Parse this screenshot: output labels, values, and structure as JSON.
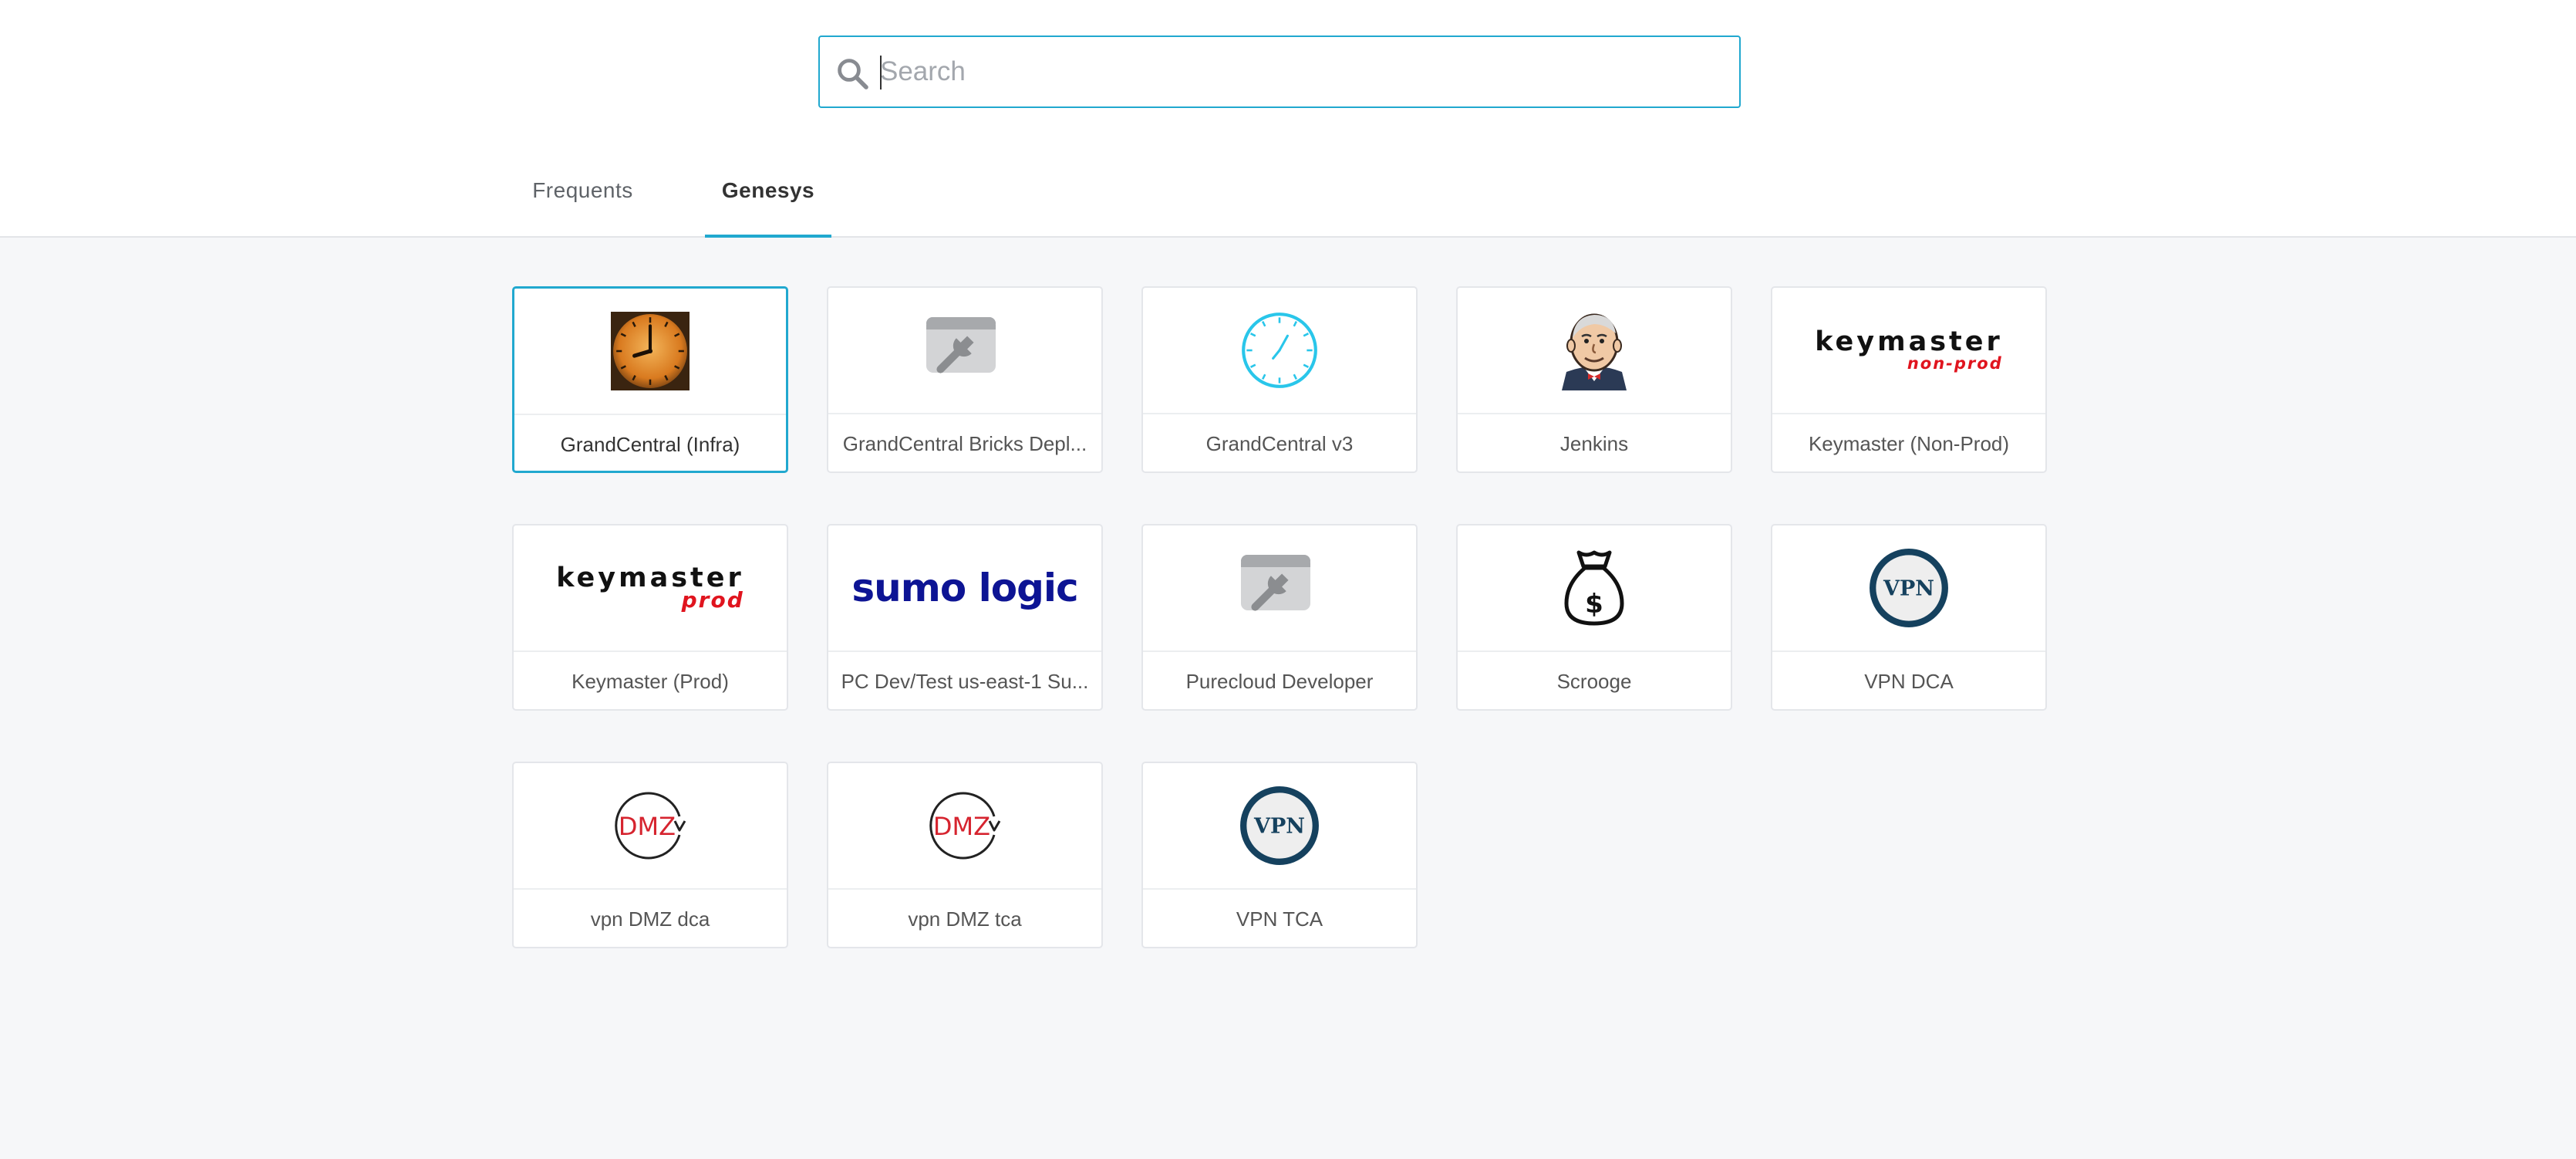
{
  "search": {
    "placeholder": "Search",
    "value": ""
  },
  "tabs": [
    {
      "label": "Frequents",
      "active": false
    },
    {
      "label": "Genesys",
      "active": true
    }
  ],
  "apps": [
    {
      "label": "GrandCentral (Infra)",
      "icon": "clock-photo-icon",
      "selected": true
    },
    {
      "label": "GrandCentral Bricks Depl...",
      "icon": "browser-wrench-icon"
    },
    {
      "label": "GrandCentral v3",
      "icon": "clock-outline-icon"
    },
    {
      "label": "Jenkins",
      "icon": "jenkins-butler-icon"
    },
    {
      "label": "Keymaster (Non-Prod)",
      "icon": "keymaster-nonprod-logo",
      "logo_text": "keymaster",
      "logo_sub": "non-prod"
    },
    {
      "label": "Keymaster (Prod)",
      "icon": "keymaster-prod-logo",
      "logo_text": "keymaster",
      "logo_sub": "prod"
    },
    {
      "label": "PC Dev/Test us-east-1 Su...",
      "icon": "sumo-logic-logo",
      "logo_text": "sumo logic"
    },
    {
      "label": "Purecloud Developer",
      "icon": "browser-wrench-icon"
    },
    {
      "label": "Scrooge",
      "icon": "money-bag-icon",
      "logo_text": "$"
    },
    {
      "label": "VPN DCA",
      "icon": "vpn-badge-icon",
      "logo_text": "VPN"
    },
    {
      "label": "vpn DMZ dca",
      "icon": "dmz-icon",
      "logo_text": "DMZ"
    },
    {
      "label": "vpn DMZ tca",
      "icon": "dmz-icon",
      "logo_text": "DMZ"
    },
    {
      "label": "VPN TCA",
      "icon": "vpn-badge-icon",
      "logo_text": "VPN"
    }
  ],
  "colors": {
    "accent": "#21a8cf",
    "keymaster_red": "#e0141e",
    "sumo_blue": "#0d1494",
    "vpn_navy": "#15415e",
    "dmz_red": "#d6242f"
  }
}
